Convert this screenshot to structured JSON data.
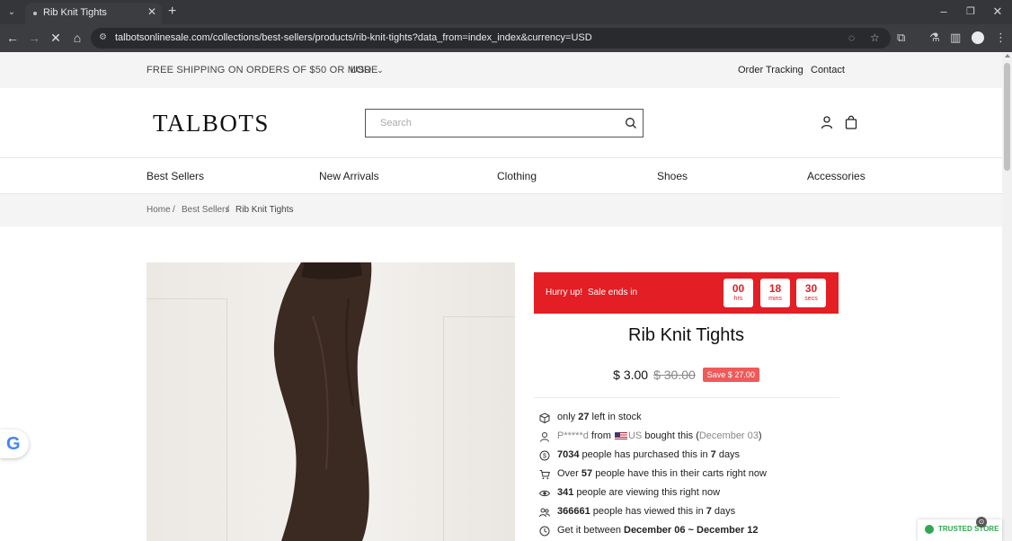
{
  "browser": {
    "tab_title": "Rib Knit Tights",
    "url": "talbotsonlinesale.com/collections/best-sellers/products/rib-knit-tights?data_from=index_index&currency=USD"
  },
  "announcement": {
    "shipping": "FREE SHIPPING ON ORDERS OF $50 OR MORE",
    "currency": "USD",
    "links": [
      "Order Tracking",
      "Contact"
    ]
  },
  "header": {
    "logo": "TALBOTS",
    "search_placeholder": "Search"
  },
  "nav": [
    "Best Sellers",
    "New Arrivals",
    "Clothing",
    "Shoes",
    "Accessories"
  ],
  "breadcrumb": {
    "home": "Home",
    "sep": "/",
    "category": "Best Sellers",
    "current": "Rib Knit Tights"
  },
  "sale": {
    "hurry": "Hurry up!",
    "ends": "Sale ends in",
    "hrs": "00",
    "hrs_label": "hrs",
    "mins": "18",
    "mins_label": "mins",
    "secs": "30",
    "secs_label": "secs"
  },
  "product": {
    "title": "Rib Knit Tights",
    "price": "$ 3.00",
    "old_price": "$ 30.00",
    "save": "Save $ 27.00"
  },
  "features": {
    "stock": {
      "pre": "only ",
      "num": "27",
      "post": " left in stock"
    },
    "bought": {
      "user": "P*****d",
      "from": " from ",
      "country": "US",
      "post": " bought this (",
      "date": "December 03",
      "close": ")"
    },
    "purchased": {
      "num": "7034",
      "mid": " people has purchased this in ",
      "days": "7",
      "post": " days"
    },
    "carts": {
      "pre": "Over ",
      "num": "57",
      "post": " people have this in their carts right now"
    },
    "viewing": {
      "num": "341",
      "post": " people are viewing this right now"
    },
    "viewed": {
      "num": "366661",
      "mid": " people has viewed this in ",
      "days": "7",
      "post": " days"
    },
    "delivery": {
      "pre": "Get it between ",
      "from": "December 06",
      "sep": " ~ ",
      "to": "December 12"
    }
  },
  "badges": {
    "trusted": "TRUSTED STORE",
    "google": "G"
  },
  "colors": {
    "sale_red": "#e31e24",
    "save_badge": "#ef5a5a",
    "trusted_green": "#2fa84f"
  }
}
